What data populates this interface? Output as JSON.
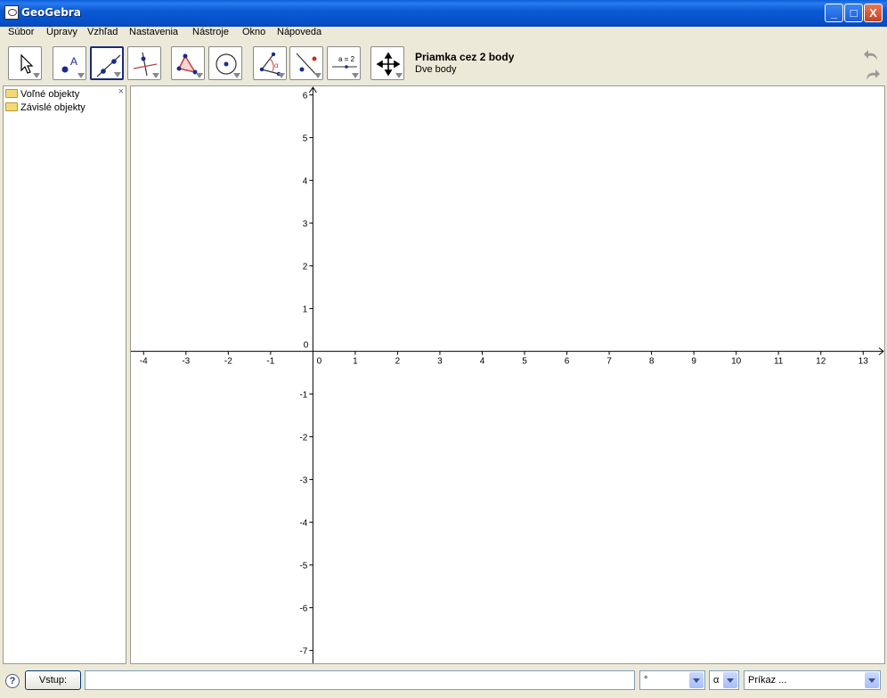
{
  "window": {
    "title": "GeoGebra",
    "min": "_",
    "max": "□",
    "close": "X"
  },
  "menu": [
    "Súbor",
    "Úpravy",
    "Vzhľad",
    "Nastavenia",
    "Nástroje",
    "Okno",
    "Nápoveda"
  ],
  "toolbar": {
    "tools": [
      {
        "name": "move-tool-button",
        "icon": "pointer-icon"
      },
      {
        "name": "point-tool-button",
        "icon": "point-a-icon"
      },
      {
        "name": "line-through-two-points-tool-button",
        "icon": "line-icon",
        "selected": true
      },
      {
        "name": "perpendicular-line-tool-button",
        "icon": "perpendicular-icon"
      },
      {
        "name": "polygon-tool-button",
        "icon": "polygon-icon"
      },
      {
        "name": "circle-tool-button",
        "icon": "circle-icon"
      },
      {
        "name": "angle-tool-button",
        "icon": "angle-icon"
      },
      {
        "name": "reflect-tool-button",
        "icon": "reflect-icon"
      },
      {
        "name": "slider-tool-button",
        "icon": "slider-icon",
        "label": "a = 2"
      },
      {
        "name": "move-graphics-tool-button",
        "icon": "move-arrows-icon"
      }
    ],
    "help_title": "Priamka cez 2 body",
    "help_desc": "Dve body"
  },
  "algebra": {
    "items": [
      "Voľné objekty",
      "Závislé objekty"
    ],
    "close": "×"
  },
  "graphics": {
    "x_ticks": [
      -4,
      -3,
      -2,
      -1,
      0,
      1,
      2,
      3,
      4,
      5,
      6,
      7,
      8,
      9,
      10,
      11,
      12,
      13
    ],
    "y_ticks": [
      6,
      5,
      4,
      3,
      2,
      1,
      0,
      -1,
      -2,
      -3,
      -4,
      -5,
      -6,
      -7
    ],
    "x_range": [
      -4.3,
      13.5
    ],
    "y_range": [
      -7.3,
      6.2
    ]
  },
  "input": {
    "help": "?",
    "button_label": "Vstup:",
    "value": "",
    "degree_value": "°",
    "symbol_value": "α",
    "command_value": "Príkaz ..."
  }
}
